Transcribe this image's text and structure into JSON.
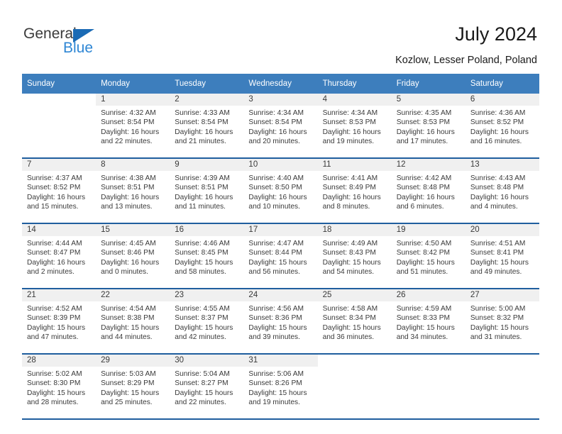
{
  "brand": {
    "name_part1": "General",
    "name_part2": "Blue",
    "triangle_icon": "triangle-icon",
    "color_dark": "#3b3b3b",
    "color_blue": "#2e86d4"
  },
  "header": {
    "title": "July 2024",
    "subtitle": "Kozlow, Lesser Poland, Poland"
  },
  "calendar": {
    "header_bg": "#3d7ebd",
    "row_divider": "#1f5e9e",
    "daynum_band_bg": "#f0f0f0",
    "weekdays": [
      "Sunday",
      "Monday",
      "Tuesday",
      "Wednesday",
      "Thursday",
      "Friday",
      "Saturday"
    ],
    "weeks": [
      [
        {
          "day": "",
          "sunrise": "",
          "sunset": "",
          "daylight_line1": "",
          "daylight_line2": ""
        },
        {
          "day": "1",
          "sunrise": "Sunrise: 4:32 AM",
          "sunset": "Sunset: 8:54 PM",
          "daylight_line1": "Daylight: 16 hours",
          "daylight_line2": "and 22 minutes."
        },
        {
          "day": "2",
          "sunrise": "Sunrise: 4:33 AM",
          "sunset": "Sunset: 8:54 PM",
          "daylight_line1": "Daylight: 16 hours",
          "daylight_line2": "and 21 minutes."
        },
        {
          "day": "3",
          "sunrise": "Sunrise: 4:34 AM",
          "sunset": "Sunset: 8:54 PM",
          "daylight_line1": "Daylight: 16 hours",
          "daylight_line2": "and 20 minutes."
        },
        {
          "day": "4",
          "sunrise": "Sunrise: 4:34 AM",
          "sunset": "Sunset: 8:53 PM",
          "daylight_line1": "Daylight: 16 hours",
          "daylight_line2": "and 19 minutes."
        },
        {
          "day": "5",
          "sunrise": "Sunrise: 4:35 AM",
          "sunset": "Sunset: 8:53 PM",
          "daylight_line1": "Daylight: 16 hours",
          "daylight_line2": "and 17 minutes."
        },
        {
          "day": "6",
          "sunrise": "Sunrise: 4:36 AM",
          "sunset": "Sunset: 8:52 PM",
          "daylight_line1": "Daylight: 16 hours",
          "daylight_line2": "and 16 minutes."
        }
      ],
      [
        {
          "day": "7",
          "sunrise": "Sunrise: 4:37 AM",
          "sunset": "Sunset: 8:52 PM",
          "daylight_line1": "Daylight: 16 hours",
          "daylight_line2": "and 15 minutes."
        },
        {
          "day": "8",
          "sunrise": "Sunrise: 4:38 AM",
          "sunset": "Sunset: 8:51 PM",
          "daylight_line1": "Daylight: 16 hours",
          "daylight_line2": "and 13 minutes."
        },
        {
          "day": "9",
          "sunrise": "Sunrise: 4:39 AM",
          "sunset": "Sunset: 8:51 PM",
          "daylight_line1": "Daylight: 16 hours",
          "daylight_line2": "and 11 minutes."
        },
        {
          "day": "10",
          "sunrise": "Sunrise: 4:40 AM",
          "sunset": "Sunset: 8:50 PM",
          "daylight_line1": "Daylight: 16 hours",
          "daylight_line2": "and 10 minutes."
        },
        {
          "day": "11",
          "sunrise": "Sunrise: 4:41 AM",
          "sunset": "Sunset: 8:49 PM",
          "daylight_line1": "Daylight: 16 hours",
          "daylight_line2": "and 8 minutes."
        },
        {
          "day": "12",
          "sunrise": "Sunrise: 4:42 AM",
          "sunset": "Sunset: 8:48 PM",
          "daylight_line1": "Daylight: 16 hours",
          "daylight_line2": "and 6 minutes."
        },
        {
          "day": "13",
          "sunrise": "Sunrise: 4:43 AM",
          "sunset": "Sunset: 8:48 PM",
          "daylight_line1": "Daylight: 16 hours",
          "daylight_line2": "and 4 minutes."
        }
      ],
      [
        {
          "day": "14",
          "sunrise": "Sunrise: 4:44 AM",
          "sunset": "Sunset: 8:47 PM",
          "daylight_line1": "Daylight: 16 hours",
          "daylight_line2": "and 2 minutes."
        },
        {
          "day": "15",
          "sunrise": "Sunrise: 4:45 AM",
          "sunset": "Sunset: 8:46 PM",
          "daylight_line1": "Daylight: 16 hours",
          "daylight_line2": "and 0 minutes."
        },
        {
          "day": "16",
          "sunrise": "Sunrise: 4:46 AM",
          "sunset": "Sunset: 8:45 PM",
          "daylight_line1": "Daylight: 15 hours",
          "daylight_line2": "and 58 minutes."
        },
        {
          "day": "17",
          "sunrise": "Sunrise: 4:47 AM",
          "sunset": "Sunset: 8:44 PM",
          "daylight_line1": "Daylight: 15 hours",
          "daylight_line2": "and 56 minutes."
        },
        {
          "day": "18",
          "sunrise": "Sunrise: 4:49 AM",
          "sunset": "Sunset: 8:43 PM",
          "daylight_line1": "Daylight: 15 hours",
          "daylight_line2": "and 54 minutes."
        },
        {
          "day": "19",
          "sunrise": "Sunrise: 4:50 AM",
          "sunset": "Sunset: 8:42 PM",
          "daylight_line1": "Daylight: 15 hours",
          "daylight_line2": "and 51 minutes."
        },
        {
          "day": "20",
          "sunrise": "Sunrise: 4:51 AM",
          "sunset": "Sunset: 8:41 PM",
          "daylight_line1": "Daylight: 15 hours",
          "daylight_line2": "and 49 minutes."
        }
      ],
      [
        {
          "day": "21",
          "sunrise": "Sunrise: 4:52 AM",
          "sunset": "Sunset: 8:39 PM",
          "daylight_line1": "Daylight: 15 hours",
          "daylight_line2": "and 47 minutes."
        },
        {
          "day": "22",
          "sunrise": "Sunrise: 4:54 AM",
          "sunset": "Sunset: 8:38 PM",
          "daylight_line1": "Daylight: 15 hours",
          "daylight_line2": "and 44 minutes."
        },
        {
          "day": "23",
          "sunrise": "Sunrise: 4:55 AM",
          "sunset": "Sunset: 8:37 PM",
          "daylight_line1": "Daylight: 15 hours",
          "daylight_line2": "and 42 minutes."
        },
        {
          "day": "24",
          "sunrise": "Sunrise: 4:56 AM",
          "sunset": "Sunset: 8:36 PM",
          "daylight_line1": "Daylight: 15 hours",
          "daylight_line2": "and 39 minutes."
        },
        {
          "day": "25",
          "sunrise": "Sunrise: 4:58 AM",
          "sunset": "Sunset: 8:34 PM",
          "daylight_line1": "Daylight: 15 hours",
          "daylight_line2": "and 36 minutes."
        },
        {
          "day": "26",
          "sunrise": "Sunrise: 4:59 AM",
          "sunset": "Sunset: 8:33 PM",
          "daylight_line1": "Daylight: 15 hours",
          "daylight_line2": "and 34 minutes."
        },
        {
          "day": "27",
          "sunrise": "Sunrise: 5:00 AM",
          "sunset": "Sunset: 8:32 PM",
          "daylight_line1": "Daylight: 15 hours",
          "daylight_line2": "and 31 minutes."
        }
      ],
      [
        {
          "day": "28",
          "sunrise": "Sunrise: 5:02 AM",
          "sunset": "Sunset: 8:30 PM",
          "daylight_line1": "Daylight: 15 hours",
          "daylight_line2": "and 28 minutes."
        },
        {
          "day": "29",
          "sunrise": "Sunrise: 5:03 AM",
          "sunset": "Sunset: 8:29 PM",
          "daylight_line1": "Daylight: 15 hours",
          "daylight_line2": "and 25 minutes."
        },
        {
          "day": "30",
          "sunrise": "Sunrise: 5:04 AM",
          "sunset": "Sunset: 8:27 PM",
          "daylight_line1": "Daylight: 15 hours",
          "daylight_line2": "and 22 minutes."
        },
        {
          "day": "31",
          "sunrise": "Sunrise: 5:06 AM",
          "sunset": "Sunset: 8:26 PM",
          "daylight_line1": "Daylight: 15 hours",
          "daylight_line2": "and 19 minutes."
        },
        {
          "day": "",
          "sunrise": "",
          "sunset": "",
          "daylight_line1": "",
          "daylight_line2": ""
        },
        {
          "day": "",
          "sunrise": "",
          "sunset": "",
          "daylight_line1": "",
          "daylight_line2": ""
        },
        {
          "day": "",
          "sunrise": "",
          "sunset": "",
          "daylight_line1": "",
          "daylight_line2": ""
        }
      ]
    ]
  }
}
